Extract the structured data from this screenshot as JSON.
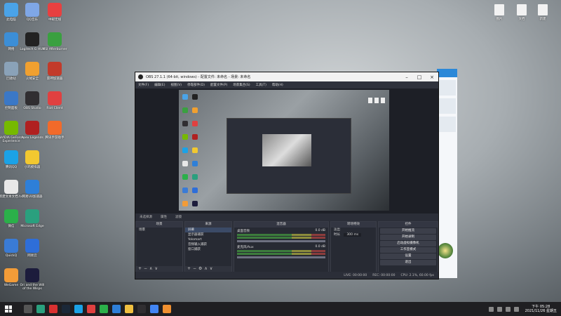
{
  "desktop": {
    "left_column": [
      {
        "label": "此电脑",
        "color": "#4aa3e8"
      },
      {
        "label": "网络",
        "color": "#3c8ed6"
      },
      {
        "label": "回收站",
        "color": "#8aa2b8"
      },
      {
        "label": "控制面板",
        "color": "#3b78c6"
      },
      {
        "label": "NVIDIA GeForce Experience",
        "color": "#76b900"
      },
      {
        "label": "腾讯QQ",
        "color": "#1ba2e6"
      },
      {
        "label": "新建文本文档.txt",
        "color": "#e8e8e8"
      },
      {
        "label": "微信",
        "color": "#2bb04a"
      },
      {
        "label": "QuickQ",
        "color": "#3a7bd5"
      },
      {
        "label": "WeGame",
        "color": "#f29c38"
      }
    ],
    "col2": [
      {
        "label": "QQ音乐",
        "color": "#7fa7e6"
      },
      {
        "label": "Logitech G HUB",
        "color": "#222222"
      },
      {
        "label": "火绒安全",
        "color": "#f0a030"
      },
      {
        "label": "OBS Studio",
        "color": "#302e31"
      },
      {
        "label": "Apex Legends",
        "color": "#b02020"
      },
      {
        "label": "小鸡模拟器",
        "color": "#f2c830"
      },
      {
        "label": "网易UU加速器",
        "color": "#2e7fd8"
      },
      {
        "label": "Microsoft Edge",
        "color": "#2aa07e"
      },
      {
        "label": "网易云",
        "color": "#2e6ed8"
      },
      {
        "label": "Ori and the Will of the Wisps",
        "color": "#1c1c3c"
      }
    ],
    "col3": [
      {
        "label": "中邮无线",
        "color": "#e84040"
      },
      {
        "label": "MSI Afterburner",
        "color": "#3aa040"
      },
      {
        "label": "雷神加速器",
        "color": "#c23a2a"
      },
      {
        "label": "Riot Client",
        "color": "#e04040"
      },
      {
        "label": "腾讯手游助手",
        "color": "#f26a2a"
      }
    ],
    "right": [
      {
        "label": "图片"
      },
      {
        "label": "文档"
      },
      {
        "label": "新建"
      }
    ]
  },
  "obs": {
    "title": "OBS 27.1.1 (64-bit, windows) - 配置文件: 未命名 - 场景: 未命名",
    "menu": [
      "文件(F)",
      "编辑(E)",
      "视图(V)",
      "停靠部件(D)",
      "配置文件(P)",
      "场景集合(S)",
      "工具(T)",
      "帮助(H)"
    ],
    "toolbar": [
      "未选择源",
      "属性",
      "滤镜"
    ],
    "docks": {
      "scenes": {
        "header": "场景",
        "items": [
          "场景"
        ]
      },
      "sources": {
        "header": "来源",
        "items": [
          "屏幕",
          "显示器捕获",
          "Yolomart",
          "音频输入捕获",
          "窗口捕获"
        ]
      },
      "mixer": {
        "header": "混音器",
        "tracks": [
          {
            "name": "桌面音频",
            "db": "0.0 dB"
          },
          {
            "name": "麦克风/Aux",
            "db": "0.0 dB"
          }
        ]
      },
      "transitions": {
        "header": "转场特效",
        "type": "淡出",
        "duration_label": "时长",
        "duration": "300 ms"
      },
      "controls": {
        "header": "控件",
        "buttons": [
          "开始推流",
          "开始录制",
          "启动虚拟摄像机",
          "工作室模式",
          "设置",
          "退出"
        ]
      }
    },
    "status": {
      "live": "LIVE: 00:00:00",
      "rec": "REC: 00:00:00",
      "cpu": "CPU: 2.1%, 60.00 fps"
    }
  },
  "taskbar": {
    "icons": [
      {
        "name": "search",
        "color": "#555"
      },
      {
        "name": "edge",
        "color": "#2aa07e"
      },
      {
        "name": "netease",
        "color": "#d93030"
      },
      {
        "name": "steam",
        "color": "#1b2838"
      },
      {
        "name": "qq",
        "color": "#1ba2e6"
      },
      {
        "name": "riot",
        "color": "#e04040"
      },
      {
        "name": "wechat",
        "color": "#2bb04a"
      },
      {
        "name": "uu",
        "color": "#2e7fd8"
      },
      {
        "name": "explorer",
        "color": "#f0c040"
      },
      {
        "name": "obs",
        "color": "#302e31"
      },
      {
        "name": "chrome",
        "color": "#4285f4"
      },
      {
        "name": "sublime",
        "color": "#f09030"
      }
    ],
    "time": "下午 05:28",
    "date": "2021/11/26 星期五"
  }
}
